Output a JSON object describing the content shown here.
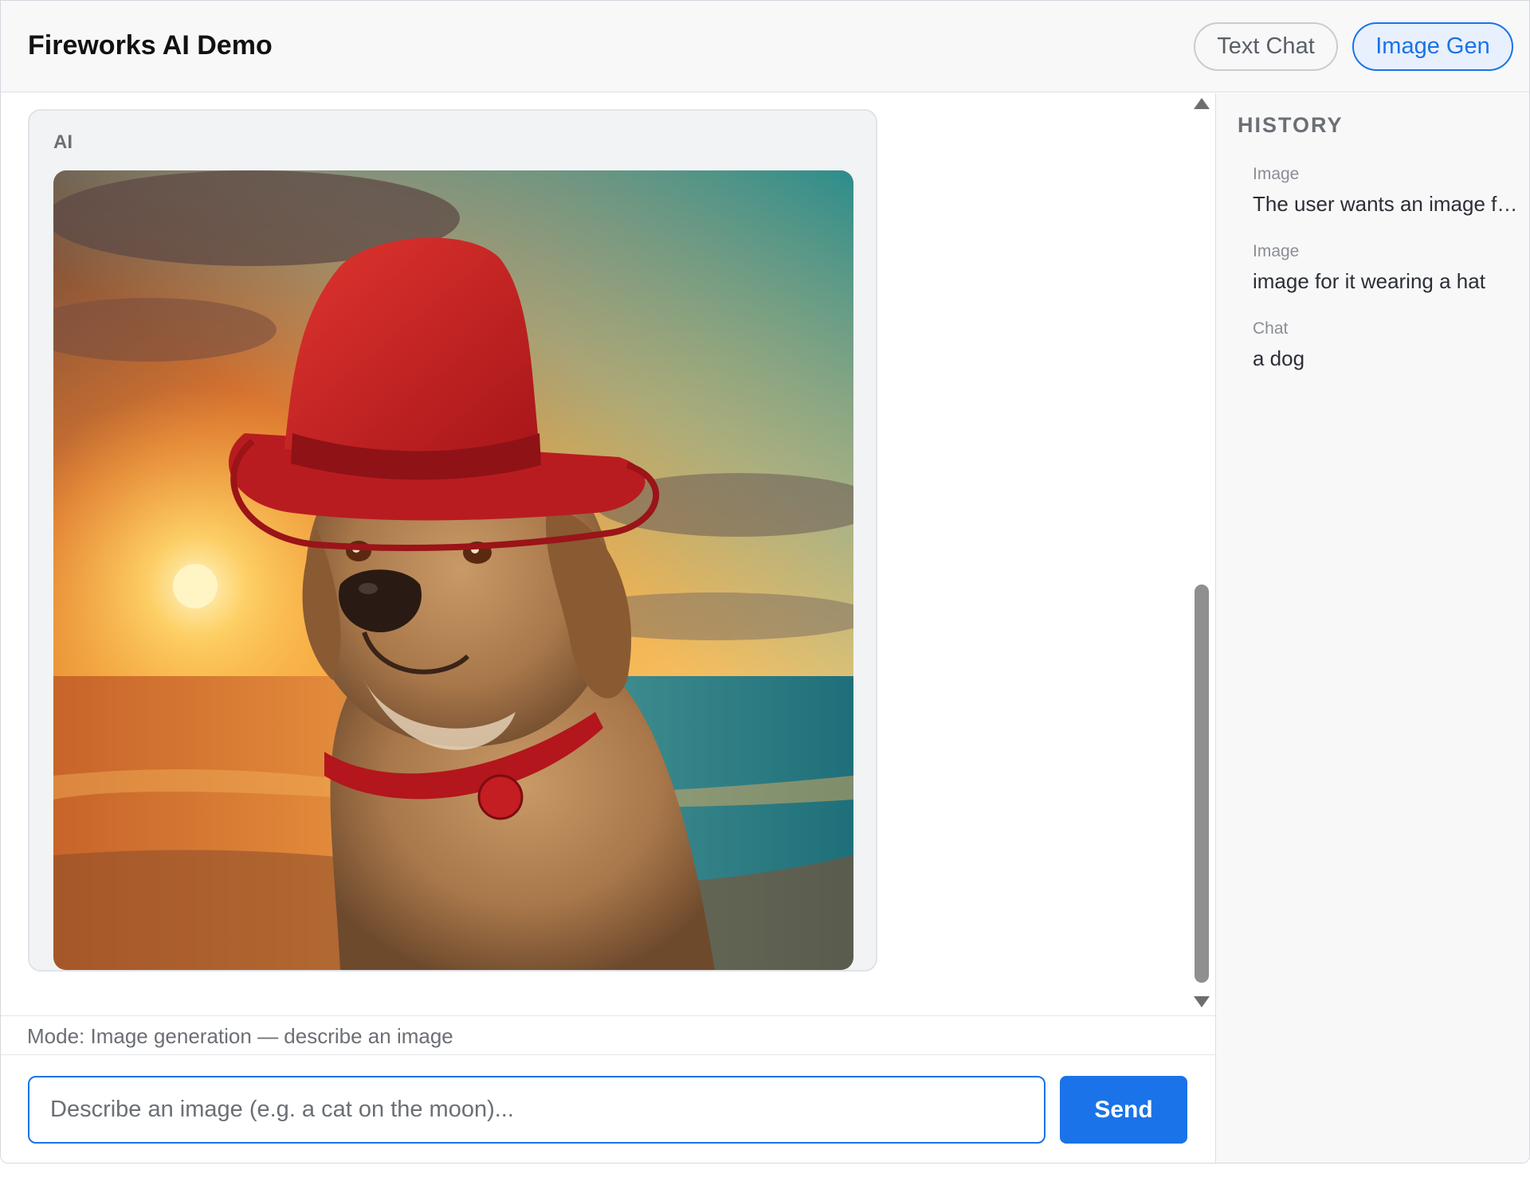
{
  "header": {
    "title": "Fireworks AI Demo",
    "modes": [
      {
        "label": "Text Chat",
        "active": false
      },
      {
        "label": "Image Gen",
        "active": true
      }
    ]
  },
  "messages": [
    {
      "sender": "AI",
      "type": "image",
      "image_subject": "dog wearing a red hat at sunset by the sea"
    }
  ],
  "mode_bar": {
    "text": "Mode: Image generation — describe an image"
  },
  "composer": {
    "placeholder": "Describe an image (e.g. a cat on the moon)...",
    "value": "",
    "send_label": "Send"
  },
  "sidebar": {
    "title": "HISTORY",
    "items": [
      {
        "kind": "Image",
        "text": "The user wants an image for it wearing a hat"
      },
      {
        "kind": "Image",
        "text": "image for it wearing a hat"
      },
      {
        "kind": "Chat",
        "text": "a dog"
      }
    ]
  },
  "colors": {
    "accent": "#1a73e8",
    "accent_soft": "#e8f0fd",
    "header_bg": "#f8f8f9",
    "card_bg": "#f2f3f5",
    "muted_text": "#6b6f75"
  },
  "icons": {
    "scroll_up": "triangle-up-icon",
    "scroll_down": "triangle-down-icon"
  }
}
